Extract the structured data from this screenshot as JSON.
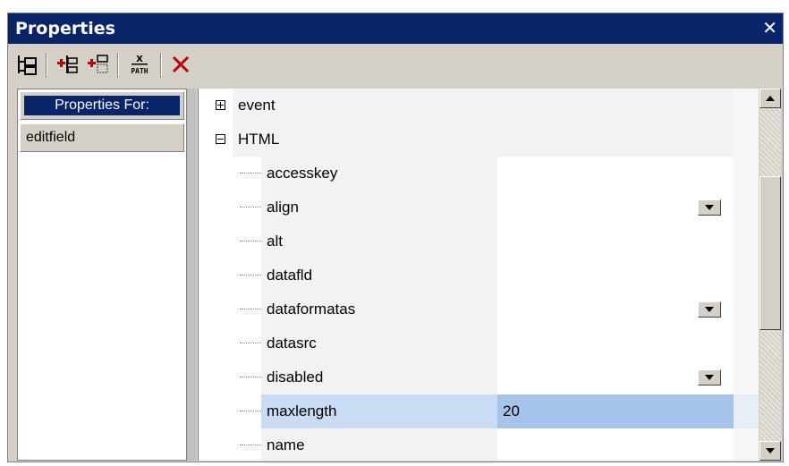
{
  "window": {
    "title": "Properties"
  },
  "toolbar": {
    "buttons": [
      {
        "icon": "tree-layout-icon"
      },
      {
        "icon": "add-child-icon"
      },
      {
        "icon": "add-sibling-icon"
      },
      {
        "icon": "xpath-icon",
        "label_top": "X",
        "label_bottom": "PATH"
      },
      {
        "icon": "delete-icon"
      }
    ]
  },
  "left_pane": {
    "header": "Properties For:",
    "items": [
      "editfield"
    ]
  },
  "groups": {
    "event": "event",
    "html": "HTML"
  },
  "properties": [
    {
      "name": "accesskey",
      "value": "",
      "dropdown": false
    },
    {
      "name": "align",
      "value": "",
      "dropdown": true
    },
    {
      "name": "alt",
      "value": "",
      "dropdown": false
    },
    {
      "name": "datafld",
      "value": "",
      "dropdown": false
    },
    {
      "name": "dataformatas",
      "value": "",
      "dropdown": true
    },
    {
      "name": "datasrc",
      "value": "",
      "dropdown": false
    },
    {
      "name": "disabled",
      "value": "",
      "dropdown": true
    },
    {
      "name": "maxlength",
      "value": "20",
      "dropdown": false,
      "selected": true
    },
    {
      "name": "name",
      "value": "",
      "dropdown": false
    }
  ],
  "colors": {
    "title_bar": "#0a246a",
    "selection": "#a6c4ea",
    "chrome": "#d4d0c8",
    "delete_icon": "#c00000"
  }
}
